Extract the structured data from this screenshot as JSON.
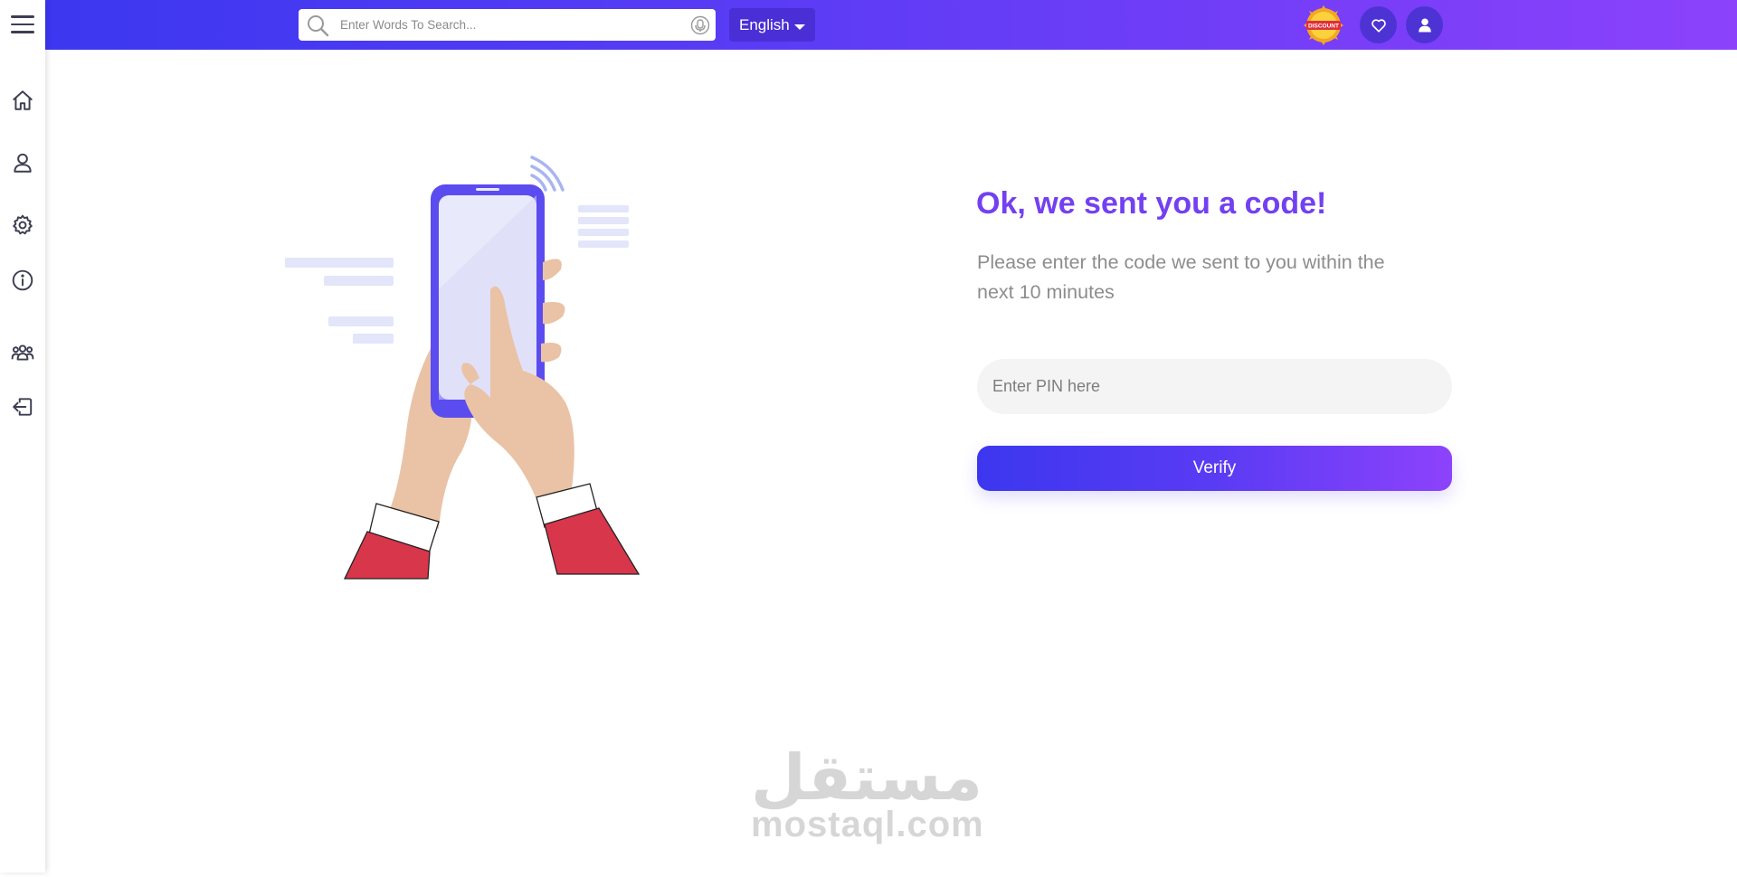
{
  "header": {
    "search": {
      "placeholder": "Enter Words To Search..."
    },
    "language": {
      "selected": "English"
    },
    "discount_badge": "DISCOUNT",
    "brand_gradient": [
      "#3a37f0",
      "#8c42fb"
    ]
  },
  "sidebar": {
    "items": [
      {
        "name": "home",
        "icon": "home-icon"
      },
      {
        "name": "profile",
        "icon": "user-icon"
      },
      {
        "name": "settings",
        "icon": "gear-icon"
      },
      {
        "name": "about",
        "icon": "info-icon"
      },
      {
        "name": "community",
        "icon": "users-group-icon"
      },
      {
        "name": "login",
        "icon": "sign-in-icon"
      }
    ]
  },
  "main": {
    "title": "Ok, we sent you a code!",
    "subtitle": "Please enter the code we sent to you within the next 10 minutes",
    "pin_placeholder": "Enter PIN here",
    "verify_label": "Verify",
    "title_color": "#7340f1"
  },
  "watermark": {
    "arabic": "مستقل",
    "latin": "mostaql.com"
  }
}
